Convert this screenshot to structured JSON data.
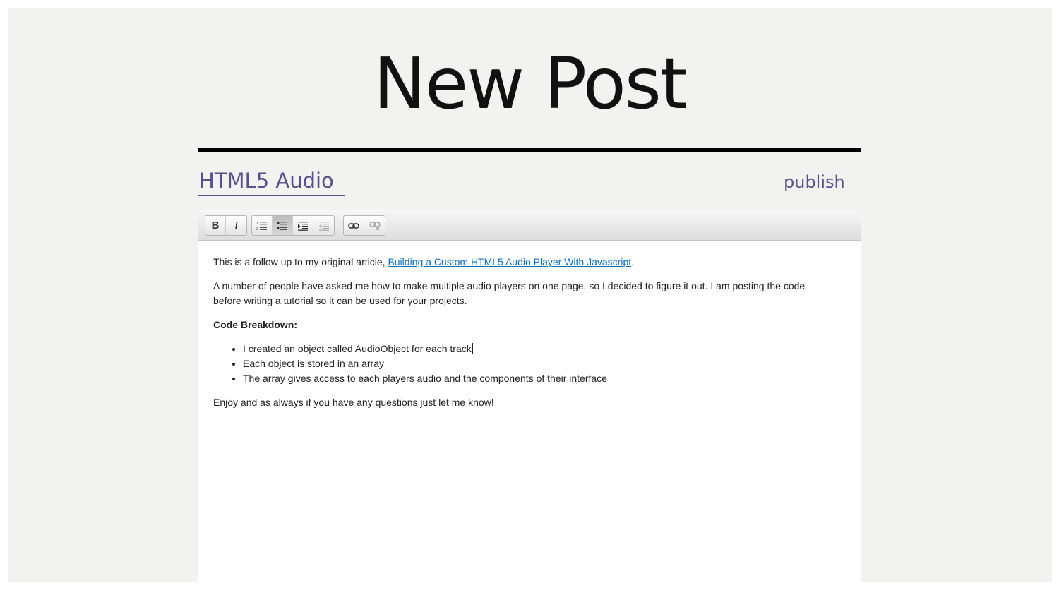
{
  "page": {
    "title": "New Post",
    "accent_color": "#5a4f8f"
  },
  "post": {
    "title_value": "HTML5 Audio",
    "publish_label": "publish"
  },
  "toolbar": {
    "bold_label": "B",
    "italic_label": "I",
    "buttons": [
      {
        "name": "bold",
        "icon": "bold-icon",
        "active": false,
        "enabled": true
      },
      {
        "name": "italic",
        "icon": "italic-icon",
        "active": false,
        "enabled": true
      },
      {
        "name": "ordered-list",
        "icon": "ordered-list-icon",
        "active": false,
        "enabled": true
      },
      {
        "name": "unordered-list",
        "icon": "unordered-list-icon",
        "active": true,
        "enabled": true
      },
      {
        "name": "indent",
        "icon": "indent-icon",
        "active": false,
        "enabled": true
      },
      {
        "name": "outdent",
        "icon": "outdent-icon",
        "active": false,
        "enabled": false
      },
      {
        "name": "link",
        "icon": "link-icon",
        "active": false,
        "enabled": true
      },
      {
        "name": "unlink",
        "icon": "unlink-icon",
        "active": false,
        "enabled": false
      }
    ]
  },
  "content": {
    "p1_text": "This is a follow up to my original article, ",
    "p1_link": "Building a Custom HTML5 Audio Player With Javascript",
    "p1_end": ".",
    "p2": "A number of people have asked me how to make multiple audio players on one page, so I decided to figure it out. I am posting the code before writing a tutorial so it can be used for your projects.",
    "heading": "Code Breakdown:",
    "bullets": [
      "I created an object called AudioObject for each track",
      "Each object is stored in an array",
      "The array gives access to each players audio and the components of their interface"
    ],
    "closing": "Enjoy and as always if you have any questions just let me know!",
    "link_color": "#0e6fc1"
  }
}
